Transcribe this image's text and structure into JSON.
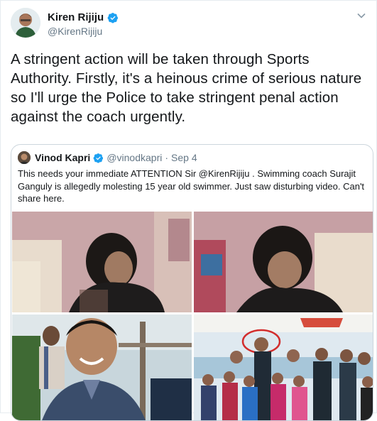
{
  "tweet": {
    "display_name": "Kiren Rijiju",
    "handle": "@KirenRijiju",
    "text": "A stringent action will be taken through Sports Authority. Firstly, it's a heinous crime of serious nature so I'll urge the Police to take stringent penal action against the coach urgently."
  },
  "quoted": {
    "display_name": "Vinod Kapri",
    "handle": "@vinodkapri",
    "separator": "·",
    "date": "Sep 4",
    "text": "This needs your immediate ATTENTION Sir @KirenRijiju . Swimming coach Surajit Ganguly is allegedly molesting 15 year old swimmer. Just saw disturbing video. Can't share here."
  },
  "icons": {
    "verified": "verified-badge-icon",
    "more": "chevron-down-icon"
  },
  "colors": {
    "verified_blue": "#1da1f2",
    "secondary_text": "#657786",
    "border": "#ccd6dd"
  }
}
